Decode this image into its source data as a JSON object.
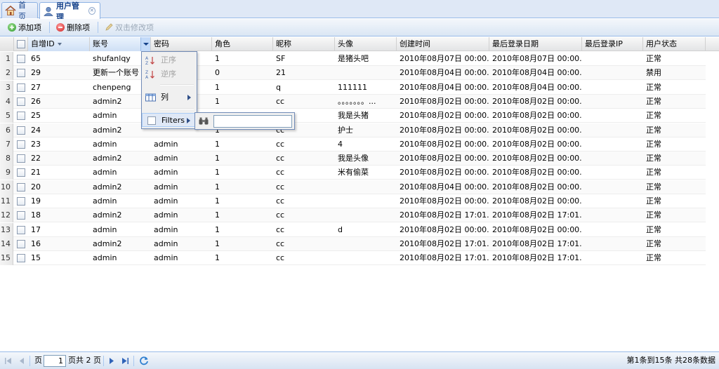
{
  "tabs": [
    {
      "label": "首页",
      "icon": "home-icon",
      "active": false
    },
    {
      "label": "用户管理",
      "icon": "user-icon",
      "active": true
    }
  ],
  "toolbar": {
    "add_label": "添加项",
    "delete_label": "删除项",
    "edit_label": "双击修改项"
  },
  "grid": {
    "columns": [
      "",
      "自增ID",
      "账号",
      "密码",
      "角色",
      "昵称",
      "头像",
      "创建时间",
      "最后登录日期",
      "最后登录IP",
      "用户状态"
    ],
    "rows": [
      {
        "num": "1",
        "id": "65",
        "account": "shufanlqy",
        "password": "",
        "role": "1",
        "nick": "SF",
        "avatar": "是猪头吧",
        "created": "2010年08月07日 00:00...",
        "lastlogin": "2010年08月07日 00:00...",
        "ip": "",
        "status": "正常"
      },
      {
        "num": "2",
        "id": "29",
        "account": "更新一个账号",
        "password": "",
        "role": "0",
        "nick": "21",
        "avatar": "",
        "created": "2010年08月04日 00:00...",
        "lastlogin": "2010年08月04日 00:00...",
        "ip": "",
        "status": "禁用"
      },
      {
        "num": "3",
        "id": "27",
        "account": "chenpeng",
        "password": "",
        "role": "1",
        "nick": "q",
        "avatar": "111111",
        "created": "2010年08月04日 00:00...",
        "lastlogin": "2010年08月04日 00:00...",
        "ip": "",
        "status": "正常"
      },
      {
        "num": "4",
        "id": "26",
        "account": "admin2",
        "password": "",
        "role": "1",
        "nick": "cc",
        "avatar": "。。。。。。。...",
        "created": "2010年08月02日 00:00...",
        "lastlogin": "2010年08月02日 00:00...",
        "ip": "",
        "status": "正常"
      },
      {
        "num": "5",
        "id": "25",
        "account": "admin",
        "password": "",
        "role": "1",
        "nick": "cc",
        "avatar": "我是头猪",
        "created": "2010年08月02日 00:00...",
        "lastlogin": "2010年08月02日 00:00...",
        "ip": "",
        "status": "正常"
      },
      {
        "num": "6",
        "id": "24",
        "account": "admin2",
        "password": "",
        "role": "1",
        "nick": "cc",
        "avatar": "护士",
        "created": "2010年08月02日 00:00...",
        "lastlogin": "2010年08月02日 00:00...",
        "ip": "",
        "status": "正常"
      },
      {
        "num": "7",
        "id": "23",
        "account": "admin",
        "password": "admin",
        "role": "1",
        "nick": "cc",
        "avatar": "4",
        "created": "2010年08月02日 00:00...",
        "lastlogin": "2010年08月02日 00:00...",
        "ip": "",
        "status": "正常"
      },
      {
        "num": "8",
        "id": "22",
        "account": "admin2",
        "password": "admin",
        "role": "1",
        "nick": "cc",
        "avatar": "我是头像",
        "created": "2010年08月02日 00:00...",
        "lastlogin": "2010年08月02日 00:00...",
        "ip": "",
        "status": "正常"
      },
      {
        "num": "9",
        "id": "21",
        "account": "admin",
        "password": "admin",
        "role": "1",
        "nick": "cc",
        "avatar": "米有偷菜",
        "created": "2010年08月02日 00:00...",
        "lastlogin": "2010年08月02日 00:00...",
        "ip": "",
        "status": "正常"
      },
      {
        "num": "10",
        "id": "20",
        "account": "admin2",
        "password": "admin",
        "role": "1",
        "nick": "cc",
        "avatar": "",
        "created": "2010年08月04日 00:00...",
        "lastlogin": "2010年08月02日 00:00...",
        "ip": "",
        "status": "正常"
      },
      {
        "num": "11",
        "id": "19",
        "account": "admin",
        "password": "admin",
        "role": "1",
        "nick": "cc",
        "avatar": "",
        "created": "2010年08月02日 00:00...",
        "lastlogin": "2010年08月02日 00:00...",
        "ip": "",
        "status": "正常"
      },
      {
        "num": "12",
        "id": "18",
        "account": "admin2",
        "password": "admin",
        "role": "1",
        "nick": "cc",
        "avatar": "",
        "created": "2010年08月02日 17:01...",
        "lastlogin": "2010年08月02日 17:01...",
        "ip": "",
        "status": "正常"
      },
      {
        "num": "13",
        "id": "17",
        "account": "admin",
        "password": "admin",
        "role": "1",
        "nick": "cc",
        "avatar": "d",
        "created": "2010年08月02日 00:00...",
        "lastlogin": "2010年08月02日 00:00...",
        "ip": "",
        "status": "正常"
      },
      {
        "num": "14",
        "id": "16",
        "account": "admin2",
        "password": "admin",
        "role": "1",
        "nick": "cc",
        "avatar": "",
        "created": "2010年08月02日 17:01...",
        "lastlogin": "2010年08月02日 17:01...",
        "ip": "",
        "status": "正常"
      },
      {
        "num": "15",
        "id": "15",
        "account": "admin",
        "password": "admin",
        "role": "1",
        "nick": "cc",
        "avatar": "",
        "created": "2010年08月02日 17:01...",
        "lastlogin": "2010年08月02日 17:01...",
        "ip": "",
        "status": "正常"
      }
    ]
  },
  "column_menu": {
    "sort_asc": "正序",
    "sort_desc": "逆序",
    "columns": "列",
    "filters": "Filters",
    "filter_value": "",
    "filter_placeholder": ""
  },
  "pager": {
    "page_label": "页",
    "page_value": "1",
    "page_total": "页共 2 页",
    "info": "第1条到15条 共28条数据"
  },
  "colors": {
    "accent": "#15428b",
    "border": "#99bbe8",
    "toolbar_bg": "#dae6f4"
  }
}
